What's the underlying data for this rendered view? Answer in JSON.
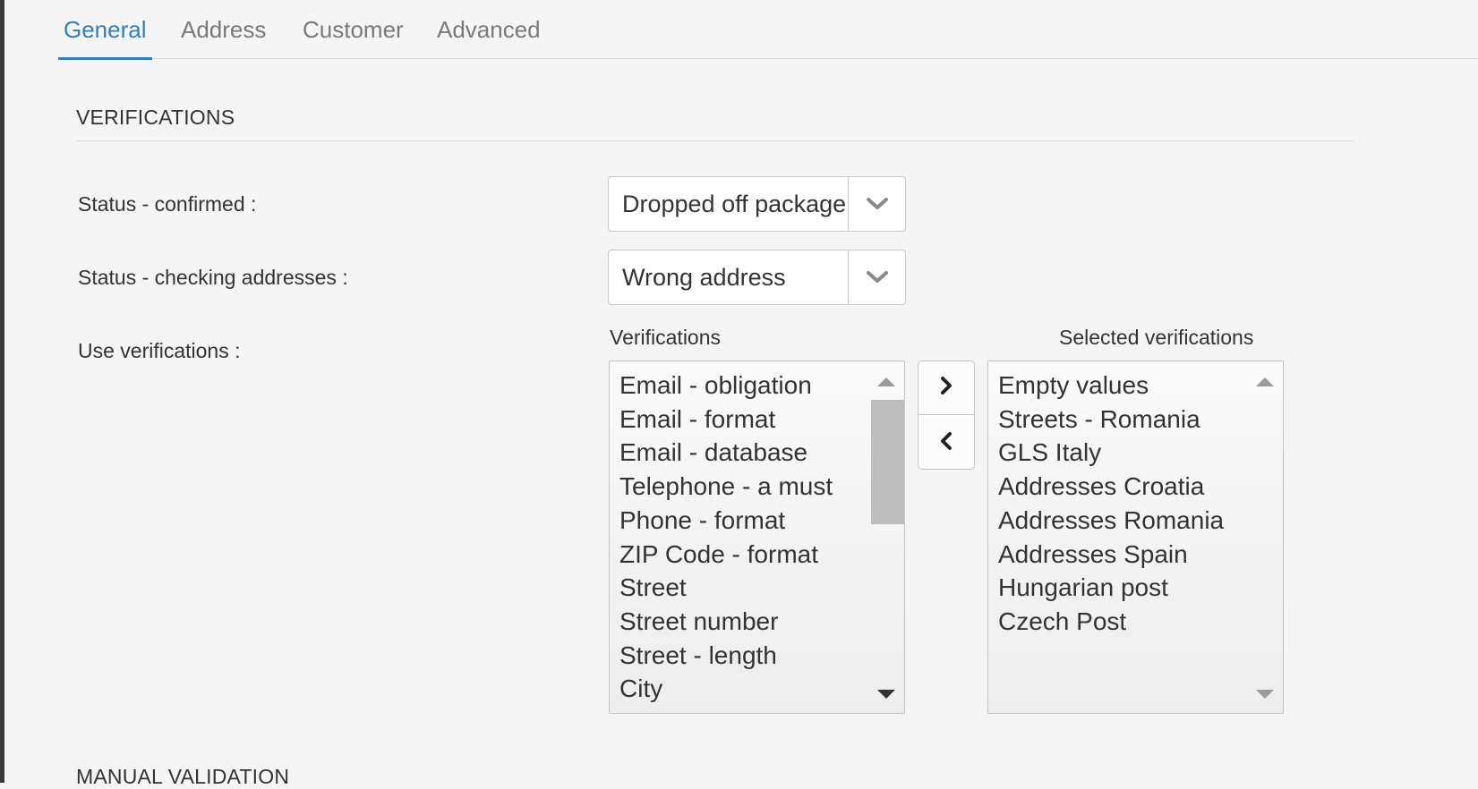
{
  "tabs": [
    {
      "label": "General",
      "active": true
    },
    {
      "label": "Address",
      "active": false
    },
    {
      "label": "Customer",
      "active": false
    },
    {
      "label": "Advanced",
      "active": false
    }
  ],
  "verifications_section": {
    "title": "VERIFICATIONS",
    "status_confirmed": {
      "label": "Status - confirmed :",
      "value": "Dropped off package"
    },
    "status_checking": {
      "label": "Status - checking addresses :",
      "value": "Wrong address"
    },
    "use_verifications_label": "Use verifications :",
    "available_caption": "Verifications",
    "selected_caption": "Selected verifications",
    "available": [
      "Email - obligation",
      "Email - format",
      "Email - database",
      "Telephone - a must",
      "Phone - format",
      "ZIP Code - format",
      "Street",
      "Street number",
      "Street - length",
      "City"
    ],
    "selected": [
      "Empty values",
      "Streets - Romania",
      "GLS Italy",
      "Addresses Croatia",
      "Addresses Romania",
      "Addresses Spain",
      "Hungarian post",
      "Czech Post"
    ]
  },
  "manual_validation": {
    "title": "MANUAL VALIDATION"
  },
  "colors": {
    "accent": "#2f7fc1",
    "border": "#c9c9c9",
    "background": "#f5f5f5"
  },
  "icons": [
    "chevron-down-icon",
    "chevron-right-icon",
    "chevron-left-icon",
    "scroll-up-icon",
    "scroll-down-icon"
  ]
}
